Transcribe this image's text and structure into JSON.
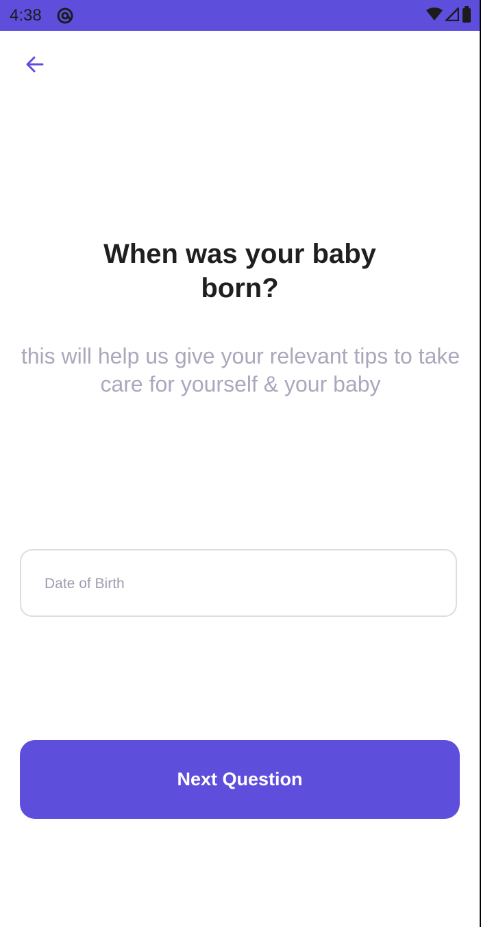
{
  "status_bar": {
    "time": "4:38",
    "app_icon": "at-sign-icon",
    "icons": [
      "wifi-icon",
      "cellular-signal-icon",
      "battery-icon"
    ],
    "background": "#5d4edc"
  },
  "header": {
    "back_icon": "arrow-left-icon",
    "accent": "#5d4edc"
  },
  "main": {
    "title": "When was your baby born?",
    "subtitle": "this will help us give your relevant tips to take care for yourself & your baby",
    "dob_placeholder": "Date of Birth"
  },
  "footer": {
    "next_label": "Next Question",
    "button_color": "#5d4edc"
  }
}
